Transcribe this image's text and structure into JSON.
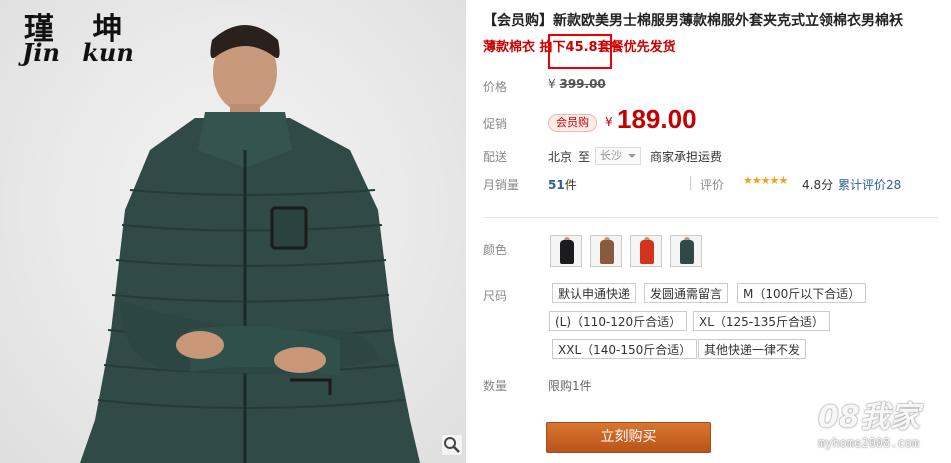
{
  "image": {
    "brand_cn": "瑾 坤",
    "brand_en": "Jin kun",
    "zoom_icon": "magnifier-icon"
  },
  "product": {
    "title": "【会员购】新款欧美男士棉服男薄款棉服外套夹克式立领棉衣男棉袄",
    "subtitle_prefix": "薄款棉衣 ",
    "subtitle_highlight": "拍下45.8",
    "subtitle_suffix": "套餐优先发货"
  },
  "price": {
    "original_label": "价格",
    "currency": "¥",
    "original_value": "399.00",
    "promo_label": "促销",
    "badge": "会员购",
    "promo_value": "189.00"
  },
  "shipping": {
    "label": "配送",
    "from": "北京",
    "to_word": "至",
    "city": "长沙",
    "note": "商家承担运费"
  },
  "sales": {
    "label": "月销量",
    "count": "51",
    "unit": "件",
    "review_label": "评价",
    "stars": "★★★★★",
    "score": "4.8分",
    "review_count": "累计评价28"
  },
  "color": {
    "label": "颜色",
    "swatches": [
      {
        "color": "#1c1c1e"
      },
      {
        "color": "#8a5a3c"
      },
      {
        "color": "#d2331d"
      },
      {
        "color": "#2f4a46"
      }
    ]
  },
  "size": {
    "label": "尺码",
    "options": [
      "默认申通快递",
      "发圆通需留言",
      "M（100斤以下合适）",
      "(L)（110-120斤合适）",
      "XL（125-135斤合适）",
      "XXL（140-150斤合适）",
      "其他快递一律不发"
    ]
  },
  "quantity": {
    "label": "数量",
    "limit": "限购1件"
  },
  "buy_button": "立刻购买",
  "watermark": {
    "text": "08我家",
    "url": "myhome2008.com"
  },
  "colors": {
    "accent": "#c40000",
    "button": "#c0601f",
    "link": "#2b5f9e"
  }
}
